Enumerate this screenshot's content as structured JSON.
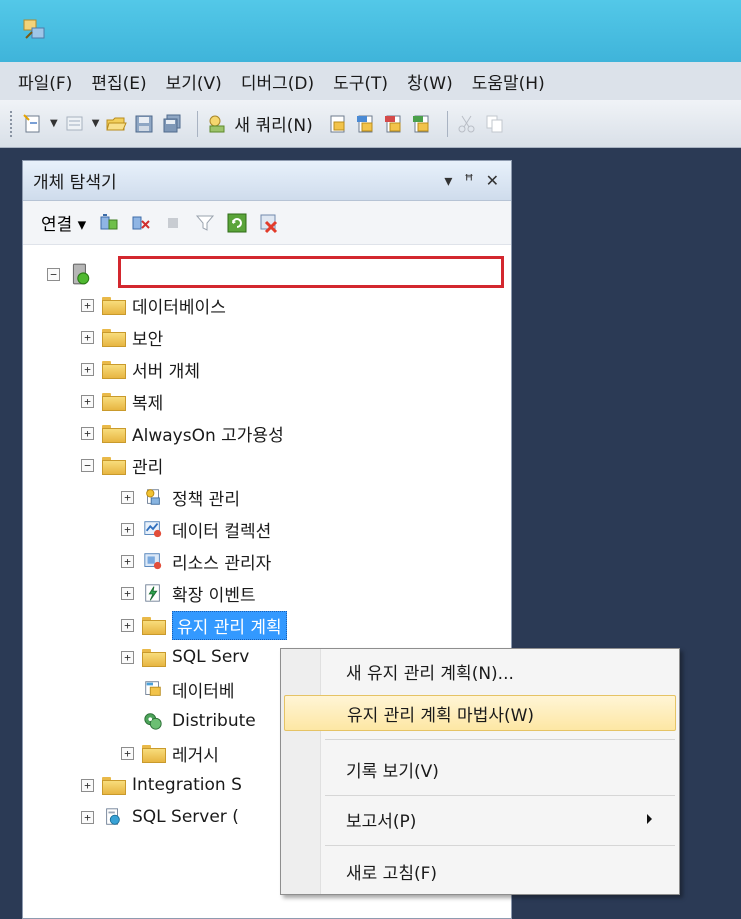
{
  "menubar": {
    "items": [
      "파일(F)",
      "편집(E)",
      "보기(V)",
      "디버그(D)",
      "도구(T)",
      "창(W)",
      "도움말(H)"
    ]
  },
  "toolbar": {
    "new_query_label": "새 쿼리(N)"
  },
  "object_explorer": {
    "title": "개체 탐색기",
    "pin_glyph": "▾",
    "pin2_glyph": "ᵩ",
    "close_glyph": "✕",
    "connect_label": "연결 ▾",
    "server_name": "",
    "tree": [
      {
        "label": "데이터베이스",
        "expander": "+"
      },
      {
        "label": "보안",
        "expander": "+"
      },
      {
        "label": "서버 개체",
        "expander": "+"
      },
      {
        "label": "복제",
        "expander": "+"
      },
      {
        "label": "AlwaysOn 고가용성",
        "expander": "+"
      },
      {
        "label": "관리",
        "expander": "−"
      },
      {
        "label": "정책 관리",
        "expander": "+"
      },
      {
        "label": "데이터 컬렉션",
        "expander": "+"
      },
      {
        "label": "리소스 관리자",
        "expander": "+"
      },
      {
        "label": "확장 이벤트",
        "expander": "+"
      },
      {
        "label": "유지 관리 계획",
        "expander": "+"
      },
      {
        "label": "SQL Serv",
        "expander": "+"
      },
      {
        "label": "데이터베",
        "expander": ""
      },
      {
        "label": "Distribute",
        "expander": ""
      },
      {
        "label": "레거시",
        "expander": "+"
      },
      {
        "label": "Integration S",
        "expander": "+"
      },
      {
        "label": "SQL Server (",
        "expander": "+"
      }
    ]
  },
  "context_menu": {
    "items": [
      "새 유지 관리 계획(N)...",
      "유지 관리 계획 마법사(W)",
      "기록 보기(V)",
      "보고서(P)",
      "새로 고침(F)"
    ]
  },
  "colors": {
    "selection": "#3399ff",
    "highlight_box": "#d3272e",
    "menu_hover": "#fde7a4"
  }
}
